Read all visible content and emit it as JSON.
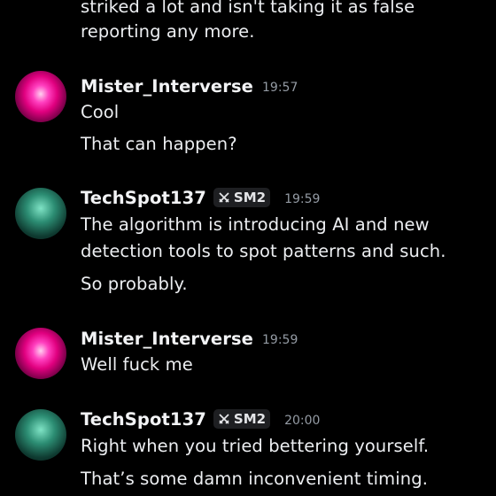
{
  "messages": [
    {
      "continuation": true,
      "lines": [
        "striked a lot and isn't taking it as false",
        "reporting any more."
      ]
    },
    {
      "author": "Mister_Interverse",
      "time": "19:57",
      "lines": [
        "Cool",
        "That can happen?"
      ]
    },
    {
      "author": "TechSpot137",
      "tag": "SM2",
      "time": "19:59",
      "lines": [
        "The algorithm is introducing AI and new",
        "detection tools to spot patterns and such.",
        "So probably."
      ]
    },
    {
      "author": "Mister_Interverse",
      "time": "19:59",
      "lines": [
        "Well fuck me"
      ]
    },
    {
      "author": "TechSpot137",
      "tag": "SM2",
      "time": "20:00",
      "lines": [
        "Right when you tried bettering yourself.",
        "That’s some damn inconvenient timing."
      ]
    }
  ],
  "icons": {
    "guild_tag": "crossed-swords-icon"
  },
  "colors": {
    "background": "#000000",
    "text": "#eceef1",
    "timestamp": "#949ba4",
    "tag_background": "#1e1f22"
  }
}
